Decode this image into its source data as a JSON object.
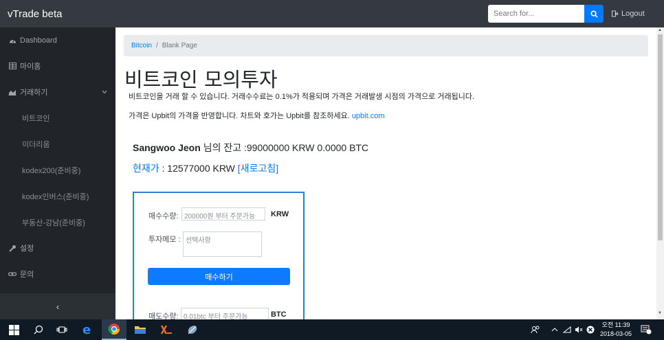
{
  "navbar": {
    "brand": "vTrade beta",
    "search_placeholder": "Search for...",
    "logout_label": "Logout"
  },
  "sidebar": {
    "items": [
      {
        "label": "Dashboard",
        "icon": "tachometer-icon"
      },
      {
        "label": "마이홈",
        "icon": "table-icon"
      },
      {
        "label": "거래하기",
        "icon": "area-chart-icon"
      },
      {
        "label": "설정",
        "icon": "wrench-icon"
      },
      {
        "label": "문의",
        "icon": "link-icon"
      }
    ],
    "sub_items": [
      "비트코인",
      "이더리움",
      "kodex200(준비중)",
      "kodex인버스(준비중)",
      "부동산-강남(준비중)"
    ],
    "toggle_label": "‹"
  },
  "breadcrumb": {
    "link": "Bitcoin",
    "separator": "/",
    "active": "Blank Page"
  },
  "main": {
    "title": "비트코인 모의투자",
    "desc1": "비트코인을 거래 할 수 있습니다. 거래수수료는 0.1%가 적용되며 가격은 거래발생 시점의 가격으로 거래됩니다.",
    "desc2": "가격은 Upbit의 가격을 반영합니다. 차트와 호가는 Upbit를 참조하세요.",
    "desc2_link": "upbit.com",
    "balance_name": "Sangwoo Jeon",
    "balance_text": "님의 잔고 :99000000 KRW 0.0000 BTC",
    "price_label": "현재가",
    "price_text": " : 12577000 KRW ",
    "price_refresh": "[새로고침]"
  },
  "trade_form": {
    "buy_qty_label": "매수수량:",
    "buy_qty_placeholder": "200000원 부터 주문가능",
    "buy_unit": "KRW",
    "memo_label": "투자메모 :",
    "memo_placeholder": "선택사항",
    "buy_button": "매수하기",
    "sell_qty_label": "매도수량:",
    "sell_qty_placeholder": "0.01btc 부터 주문가능",
    "sell_unit": "BTC"
  },
  "taskbar": {
    "clock_time": "오전 11:39",
    "clock_date": "2018-03-05"
  },
  "colors": {
    "navbar": "#343a40",
    "sidebar": "#212529",
    "accent": "#007bff",
    "taskbar": "#101a24"
  }
}
